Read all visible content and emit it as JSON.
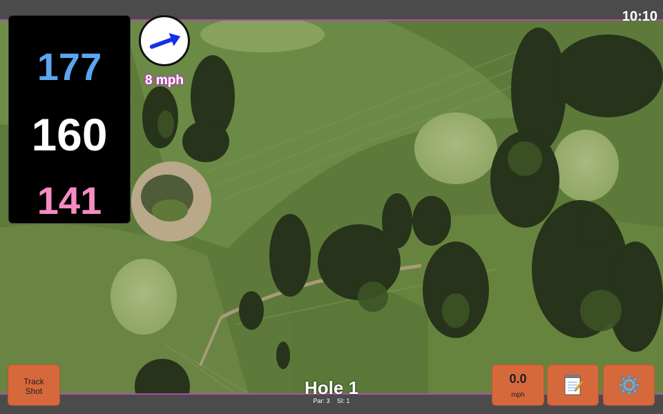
{
  "status_bar": {
    "time": "10:10"
  },
  "distances": {
    "back": "177",
    "middle": "160",
    "front": "141"
  },
  "wind": {
    "speed": "8 mph",
    "direction_icon": "arrow-icon"
  },
  "buttons": {
    "track_shot_line1": "Track",
    "track_shot_line2": "Shot",
    "speed_value": "0.0",
    "speed_unit": "mph",
    "notes_icon": "notepad-icon",
    "settings_icon": "gear-icon"
  },
  "hole": {
    "title": "Hole 1",
    "par": "Par: 3",
    "si": "SI: 1"
  },
  "colors": {
    "accent_border": "#b54bb0",
    "back_distance": "#5aa6f0",
    "middle_distance": "#ffffff",
    "front_distance": "#f58bc2",
    "button": "#d6693c"
  }
}
